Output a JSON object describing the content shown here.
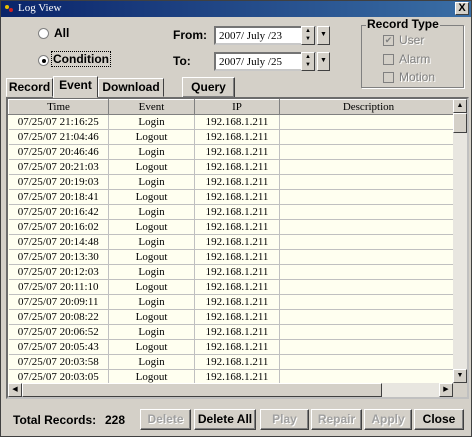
{
  "window": {
    "title": "Log View",
    "close_glyph": "X"
  },
  "filter": {
    "all_label": "All",
    "condition_label": "Condition",
    "from_label": "From:",
    "to_label": "To:",
    "from_date": "2007/  July  /23",
    "to_date": "2007/  July  /25",
    "selected_mode": "Condition"
  },
  "record_type": {
    "title": "Record Type",
    "options": [
      {
        "label": "User",
        "checked": true,
        "enabled": false
      },
      {
        "label": "Alarm",
        "checked": false,
        "enabled": false
      },
      {
        "label": "Motion",
        "checked": false,
        "enabled": false
      }
    ]
  },
  "tabs": {
    "record": "Record",
    "event": "Event",
    "download": "Download",
    "active": "Event"
  },
  "query_label": "Query",
  "table": {
    "columns": [
      "Time",
      "Event",
      "IP",
      "Description"
    ],
    "rows": [
      [
        "07/25/07 21:16:25",
        "Login",
        "192.168.1.211",
        ""
      ],
      [
        "07/25/07 21:04:46",
        "Logout",
        "192.168.1.211",
        ""
      ],
      [
        "07/25/07 20:46:46",
        "Login",
        "192.168.1.211",
        ""
      ],
      [
        "07/25/07 20:21:03",
        "Logout",
        "192.168.1.211",
        ""
      ],
      [
        "07/25/07 20:19:03",
        "Login",
        "192.168.1.211",
        ""
      ],
      [
        "07/25/07 20:18:41",
        "Logout",
        "192.168.1.211",
        ""
      ],
      [
        "07/25/07 20:16:42",
        "Login",
        "192.168.1.211",
        ""
      ],
      [
        "07/25/07 20:16:02",
        "Logout",
        "192.168.1.211",
        ""
      ],
      [
        "07/25/07 20:14:48",
        "Login",
        "192.168.1.211",
        ""
      ],
      [
        "07/25/07 20:13:30",
        "Logout",
        "192.168.1.211",
        ""
      ],
      [
        "07/25/07 20:12:03",
        "Login",
        "192.168.1.211",
        ""
      ],
      [
        "07/25/07 20:11:10",
        "Logout",
        "192.168.1.211",
        ""
      ],
      [
        "07/25/07 20:09:11",
        "Login",
        "192.168.1.211",
        ""
      ],
      [
        "07/25/07 20:08:22",
        "Logout",
        "192.168.1.211",
        ""
      ],
      [
        "07/25/07 20:06:52",
        "Login",
        "192.168.1.211",
        ""
      ],
      [
        "07/25/07 20:05:43",
        "Logout",
        "192.168.1.211",
        ""
      ],
      [
        "07/25/07 20:03:58",
        "Login",
        "192.168.1.211",
        ""
      ],
      [
        "07/25/07 20:03:05",
        "Logout",
        "192.168.1.211",
        ""
      ]
    ]
  },
  "footer": {
    "total_label": "Total Records:",
    "total_value": "228",
    "buttons": [
      {
        "label": "Delete",
        "enabled": false
      },
      {
        "label": "Delete All",
        "enabled": true
      },
      {
        "label": "Play",
        "enabled": false
      },
      {
        "label": "Repair",
        "enabled": false
      },
      {
        "label": "Apply",
        "enabled": false
      },
      {
        "label": "Close",
        "enabled": true
      }
    ]
  },
  "icons": {
    "app": "log-app-icon",
    "spin_up": "▲",
    "spin_down": "▼",
    "dropdown": "▼",
    "scroll_up": "▲",
    "scroll_down": "▼",
    "scroll_left": "◀",
    "scroll_right": "▶",
    "check": "✔"
  },
  "colors": {
    "titlebar": "#0a246a",
    "list_background": "#fffff0",
    "face": "#d4d0c8"
  }
}
